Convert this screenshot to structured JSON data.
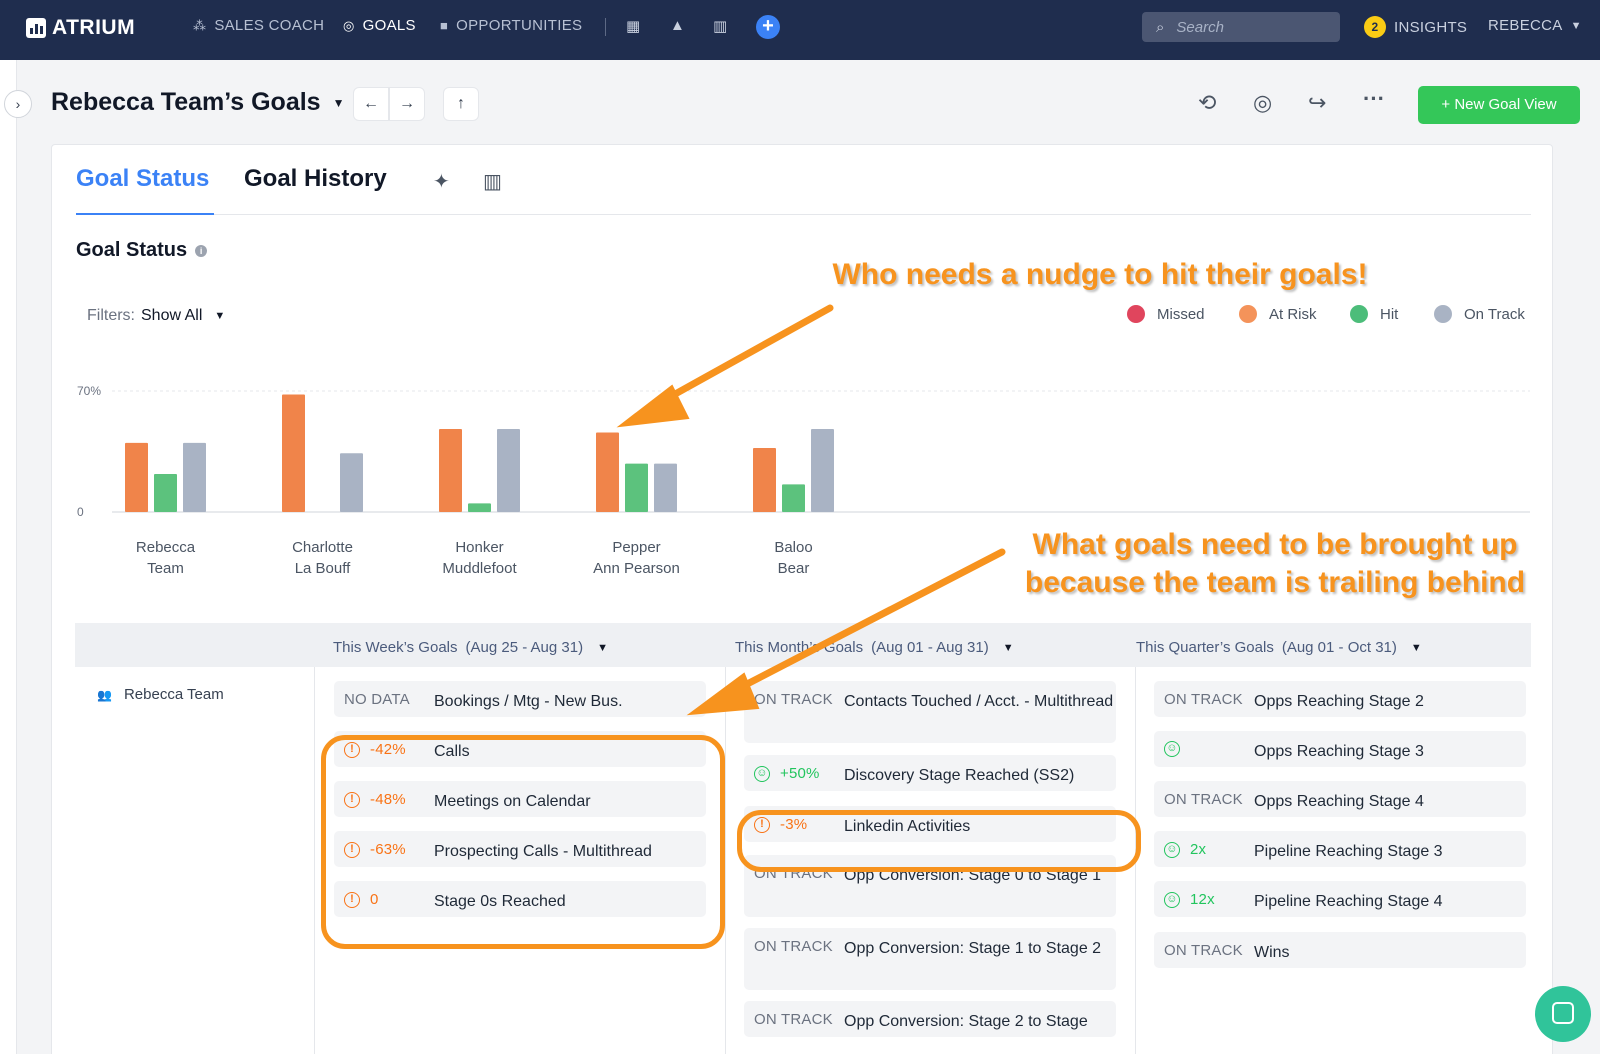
{
  "brand": {
    "name": "ATRIUM"
  },
  "nav": {
    "items": [
      {
        "label": "SALES COACH",
        "icon": "sparkle-icon"
      },
      {
        "label": "GOALS",
        "icon": "target-icon"
      },
      {
        "label": "OPPORTUNITIES",
        "icon": "briefcase-icon"
      }
    ],
    "search_placeholder": "Search",
    "insights_count": "2",
    "insights_label": "INSIGHTS",
    "user": "REBECCA"
  },
  "page": {
    "title": "Rebecca Team’s Goals",
    "new_goal_label": "New Goal View"
  },
  "tabs": [
    {
      "label": "Goal Status"
    },
    {
      "label": "Goal History"
    }
  ],
  "status": {
    "title": "Goal Status",
    "filters_label": "Filters:",
    "filters_value": "Show All",
    "legend": [
      {
        "label": "Missed",
        "color": "#e0455d"
      },
      {
        "label": "At Risk",
        "color": "#f4935a"
      },
      {
        "label": "Hit",
        "color": "#4cbd7a"
      },
      {
        "label": "On Track",
        "color": "#a9b3c4"
      }
    ]
  },
  "chart_data": {
    "type": "bar",
    "categories": [
      [
        "Rebecca",
        "Team"
      ],
      [
        "Charlotte",
        "La Bouff"
      ],
      [
        "Honker",
        "Muddlefoot"
      ],
      [
        "Pepper",
        "Ann Pearson"
      ],
      [
        "Baloo",
        "Bear"
      ]
    ],
    "y_tick_labels": [
      "70%",
      "0"
    ],
    "ylim": [
      0,
      70
    ],
    "series": [
      {
        "name": "At Risk",
        "color": "#f0844a",
        "values": [
          40,
          68,
          48,
          46,
          37
        ]
      },
      {
        "name": "Hit",
        "color": "#5cc27d",
        "values": [
          22,
          0,
          5,
          28,
          16
        ]
      },
      {
        "name": "On Track",
        "color": "#a9b3c4",
        "values": [
          40,
          34,
          48,
          28,
          48
        ]
      }
    ]
  },
  "goals": {
    "row_label": "Rebecca Team",
    "periods": [
      {
        "label": "This Week’s Goals",
        "range": "(Aug 25 - Aug 31)"
      },
      {
        "label": "This Month’s Goals",
        "range": "(Aug 01 - Aug 31)"
      },
      {
        "label": "This Quarter’s Goals",
        "range": "(Aug 01 - Oct 31)"
      }
    ],
    "week": [
      {
        "status": "NO DATA",
        "name": "Bookings / Mtg - New Bus."
      },
      {
        "status": "-42%",
        "name": "Calls"
      },
      {
        "status": "-48%",
        "name": "Meetings on Calendar"
      },
      {
        "status": "-63%",
        "name": "Prospecting Calls - Multithread"
      },
      {
        "status": "0",
        "name": "Stage 0s Reached"
      }
    ],
    "month": [
      {
        "status": "ON TRACK",
        "name": "Contacts Touched / Acct. - Multithread"
      },
      {
        "status": "+50%",
        "name": "Discovery Stage Reached (SS2)"
      },
      {
        "status": "-3%",
        "name": "Linkedin Activities"
      },
      {
        "status": "ON TRACK",
        "name": "Opp Conversion: Stage 0 to Stage 1"
      },
      {
        "status": "ON TRACK",
        "name": "Opp Conversion: Stage 1 to Stage 2"
      },
      {
        "status": "ON TRACK",
        "name": "Opp Conversion: Stage 2 to Stage"
      }
    ],
    "quarter": [
      {
        "status": "ON TRACK",
        "name": "Opps Reaching Stage 2"
      },
      {
        "status": "",
        "name": "Opps Reaching Stage 3"
      },
      {
        "status": "ON TRACK",
        "name": "Opps Reaching Stage 4"
      },
      {
        "status": "2x",
        "name": "Pipeline Reaching Stage 3"
      },
      {
        "status": "12x",
        "name": "Pipeline Reaching Stage 4"
      },
      {
        "status": "ON TRACK",
        "name": "Wins"
      }
    ]
  },
  "annotations": {
    "nudge": "Who needs a nudge to hit their goals!",
    "trailing_line1": "What goals need to be brought up",
    "trailing_line2": "because the team is trailing behind"
  }
}
